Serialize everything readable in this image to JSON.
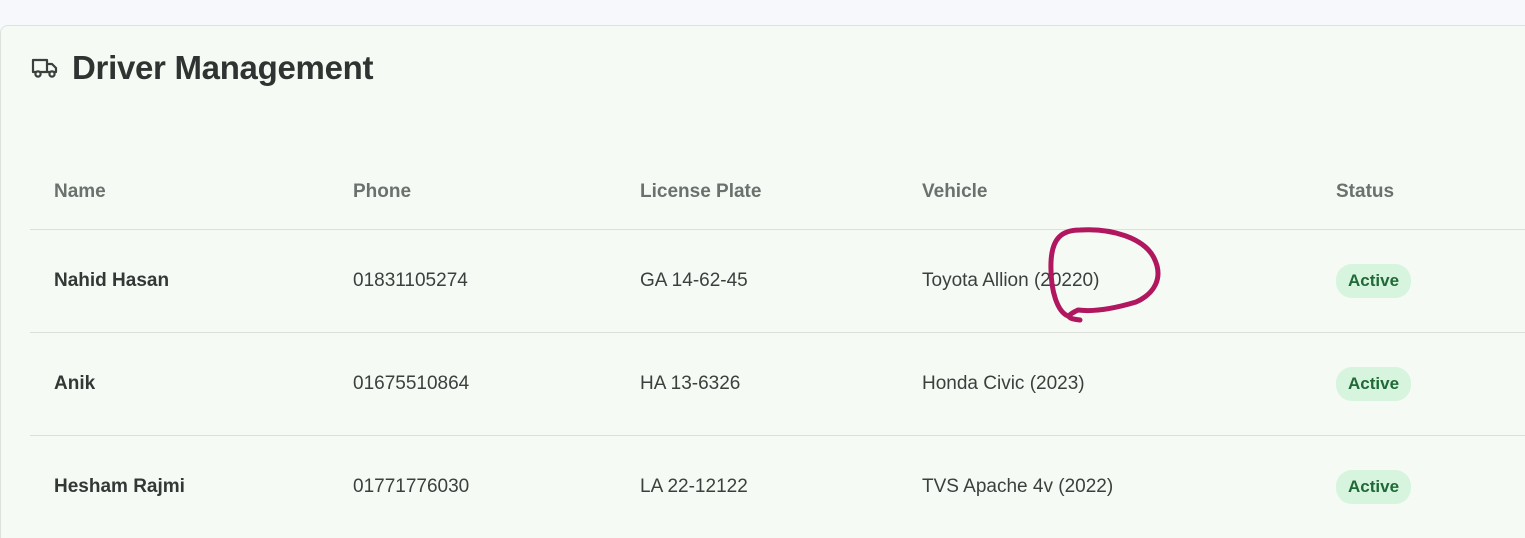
{
  "page": {
    "title": "Driver Management",
    "icon": "truck-icon"
  },
  "table": {
    "columns": [
      "Name",
      "Phone",
      "License Plate",
      "Vehicle",
      "Status"
    ],
    "rows": [
      {
        "name": "Nahid Hasan",
        "phone": "01831105274",
        "plate": "GA 14-62-45",
        "vehicle": "Toyota Allion (20220)",
        "status": "Active"
      },
      {
        "name": "Anik",
        "phone": "01675510864",
        "plate": "HA 13-6326",
        "vehicle": "Honda Civic (2023)",
        "status": "Active"
      },
      {
        "name": "Hesham Rajmi",
        "phone": "01771776030",
        "plate": "LA 22-12122",
        "vehicle": "TVS Apache 4v (2022)",
        "status": "Active"
      }
    ]
  },
  "colors": {
    "card_background": "#f5faf4",
    "status_badge_bg": "#d7f4de",
    "status_badge_text": "#1f6a36",
    "annotation_stroke": "#b0175f"
  }
}
